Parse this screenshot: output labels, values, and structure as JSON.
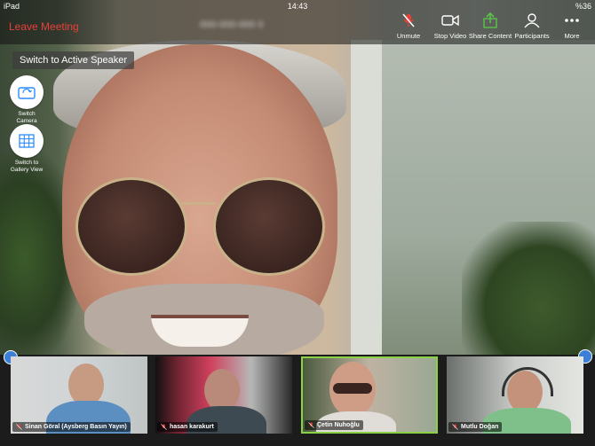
{
  "status": {
    "device": "iPad",
    "time": "14:43",
    "battery": "%36"
  },
  "header": {
    "leave_label": "Leave Meeting",
    "meeting_id": "000-000-000 0"
  },
  "toolbar": {
    "unmute_label": "Unmute",
    "stop_video_label": "Stop Video",
    "share_label": "Share Content",
    "participants_label": "Participants",
    "more_label": "More"
  },
  "overlay": {
    "active_speaker_label": "Switch to Active Speaker",
    "switch_camera_label": "Switch Camera",
    "gallery_view_label": "Switch to Gallery View"
  },
  "participants": [
    {
      "name": "Sinan Göral (Aysberg Basın Yayın)"
    },
    {
      "name": "hasan karakurt"
    },
    {
      "name": "Çetin Nuhoğlu",
      "active": true
    },
    {
      "name": "Mutlu Doğan"
    }
  ],
  "colors": {
    "leave": "#e8413a",
    "active_border": "#8ad145",
    "accent": "#3b7fd6"
  },
  "icons": [
    "mic-muted-icon",
    "video-camera-icon",
    "share-arrow-icon",
    "participants-icon",
    "more-dots-icon",
    "switch-camera-icon",
    "gallery-grid-icon"
  ]
}
